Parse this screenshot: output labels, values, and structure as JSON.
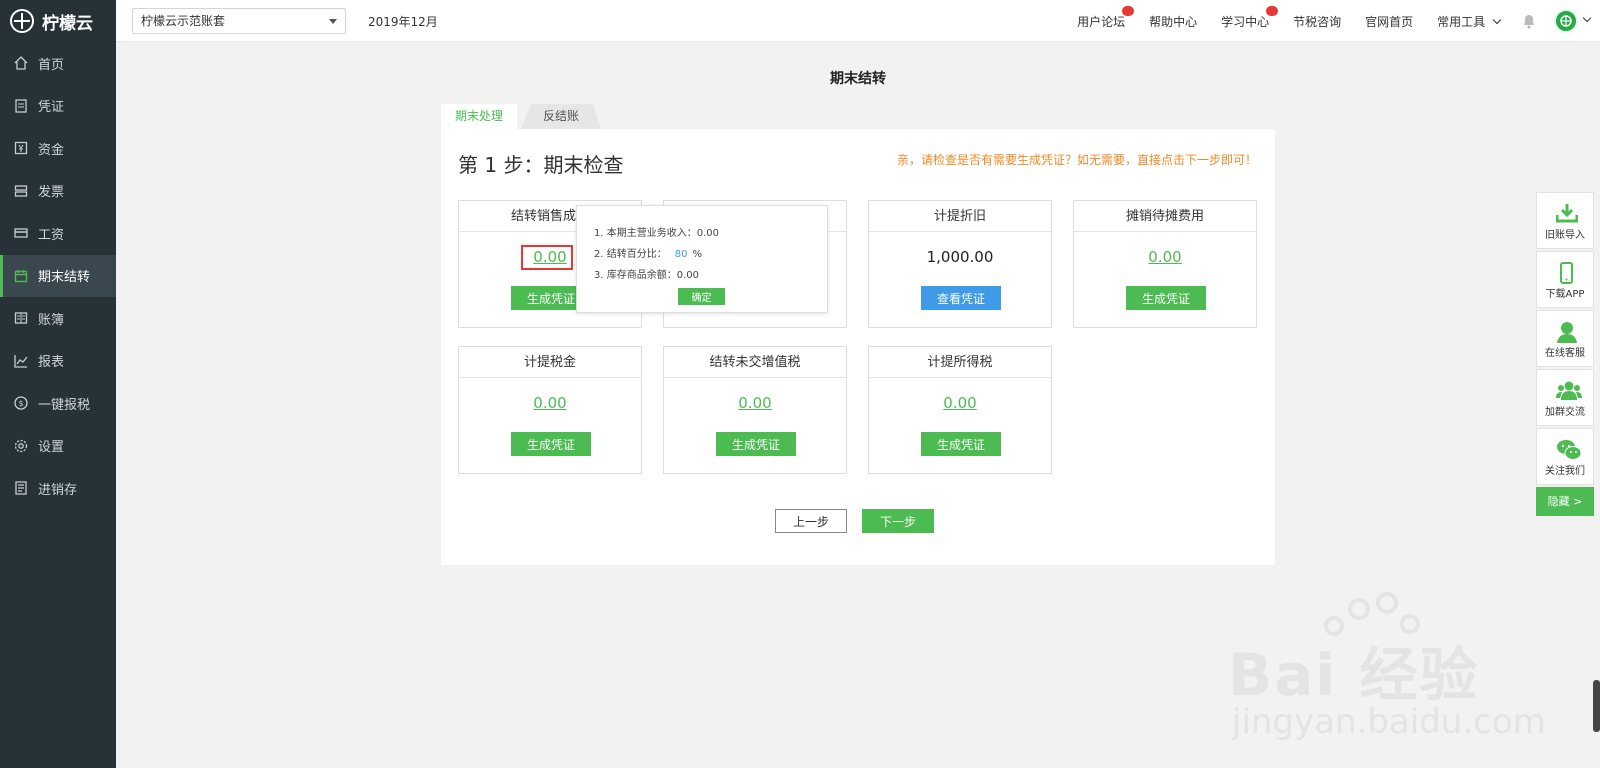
{
  "app": {
    "name": "柠檬云"
  },
  "sidebar": {
    "items": [
      {
        "label": "首页",
        "icon": "home-icon"
      },
      {
        "label": "凭证",
        "icon": "voucher-icon"
      },
      {
        "label": "资金",
        "icon": "fund-icon"
      },
      {
        "label": "发票",
        "icon": "invoice-icon"
      },
      {
        "label": "工资",
        "icon": "salary-icon"
      },
      {
        "label": "期末结转",
        "icon": "calendar-icon",
        "active": true
      },
      {
        "label": "账簿",
        "icon": "book-icon"
      },
      {
        "label": "报表",
        "icon": "chart-icon"
      },
      {
        "label": "一键报税",
        "icon": "dollar-icon"
      },
      {
        "label": "设置",
        "icon": "gear-icon"
      },
      {
        "label": "进销存",
        "icon": "inventory-icon"
      }
    ]
  },
  "topbar": {
    "account": "柠檬云示范账套",
    "period": "2019年12月",
    "links": {
      "forum": "用户论坛",
      "help": "帮助中心",
      "learn": "学习中心",
      "tax": "节税咨询",
      "official": "官网首页",
      "tools": "常用工具"
    }
  },
  "page": {
    "title": "期末结转",
    "tabs": {
      "active": "期末处理",
      "other": "反结账"
    },
    "step_title": "第 1 步：期末检查",
    "hint": "亲，请检查是否有需要生成凭证？如无需要，直接点击下一步即可！"
  },
  "cards": {
    "c1": {
      "title": "结转销售成本",
      "value": "0.00",
      "button": "生成凭证"
    },
    "c2": {
      "title": "",
      "value": "",
      "button": ""
    },
    "c3": {
      "title": "计提折旧",
      "value": "1,000.00",
      "button": "查看凭证"
    },
    "c4": {
      "title": "摊销待摊费用",
      "value": "0.00",
      "button": "生成凭证"
    },
    "c5": {
      "title": "计提税金",
      "value": "0.00",
      "button": "生成凭证"
    },
    "c6": {
      "title": "结转未交增值税",
      "value": "0.00",
      "button": "生成凭证"
    },
    "c7": {
      "title": "计提所得税",
      "value": "0.00",
      "button": "生成凭证"
    }
  },
  "popup": {
    "line1": "1. 本期主营业务收入：0.00",
    "line2_label": "2. 结转百分比：",
    "line2_value": "80",
    "line2_unit": "%",
    "line3": "3. 库存商品余额：0.00",
    "confirm": "确定"
  },
  "nav_buttons": {
    "prev": "上一步",
    "next": "下一步"
  },
  "float_panel": {
    "items": [
      {
        "label": "旧账导入",
        "icon": "download-icon"
      },
      {
        "label": "下载APP",
        "icon": "phone-icon"
      },
      {
        "label": "在线客服",
        "icon": "user-icon"
      },
      {
        "label": "加群交流",
        "icon": "group-icon"
      },
      {
        "label": "关注我们",
        "icon": "wechat-icon"
      }
    ],
    "hide": "隐藏 >"
  },
  "watermark": {
    "main": "Bai 经验",
    "sub": "jingyan.baidu.com"
  },
  "colors": {
    "accent": "#4cbb52",
    "sidebar": "#263238",
    "blue": "#3f9ae8",
    "hint": "#f08a24"
  }
}
